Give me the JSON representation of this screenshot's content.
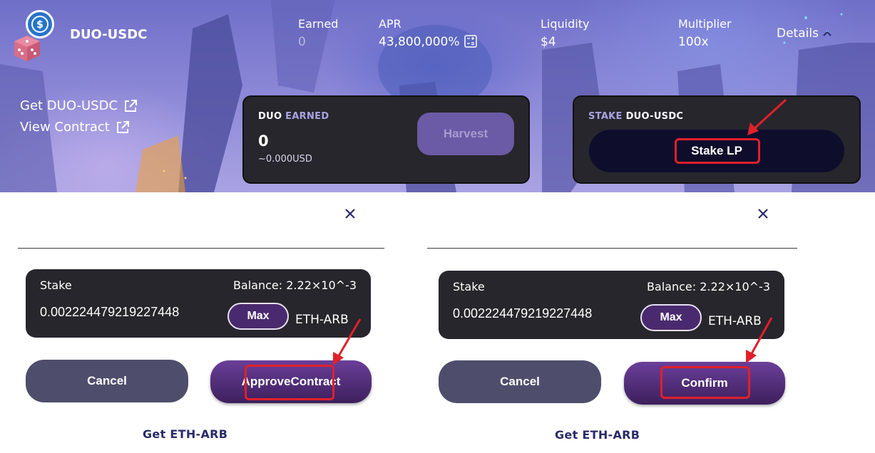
{
  "farm": {
    "pair_name": "DUO-USDC",
    "stats": {
      "earned_label": "Earned",
      "earned_value": "0",
      "apr_label": "APR",
      "apr_value": "43,800,000%",
      "liquidity_label": "Liquidity",
      "liquidity_value": "$4",
      "multiplier_label": "Multiplier",
      "multiplier_value": "100x"
    },
    "details_label": "Details",
    "links": {
      "get_pair": "Get DUO-USDC",
      "view_contract": "View Contract"
    },
    "earned_card": {
      "title_token": "DUO",
      "title_suffix": "EARNED",
      "value": "0",
      "usd_value": "~0.000USD",
      "harvest_label": "Harvest"
    },
    "stake_card": {
      "title_prefix": "STAKE",
      "title_token": "DUO-USDC",
      "stake_lp_label": "Stake LP"
    }
  },
  "modal_approve": {
    "stake_label": "Stake",
    "balance": "Balance: 2.22×10^-3",
    "input_value": "0.002224479219227448",
    "max_label": "Max",
    "token": "ETH-ARB",
    "cancel_label": "Cancel",
    "primary_label_line1": "Approve",
    "primary_label_line2": "Contract",
    "get_token_link": "Get ETH-ARB"
  },
  "modal_confirm": {
    "stake_label": "Stake",
    "balance": "Balance: 2.22×10^-3",
    "input_value": "0.002224479219227448",
    "max_label": "Max",
    "token": "ETH-ARB",
    "cancel_label": "Cancel",
    "primary_label": "Confirm",
    "get_token_link": "Get ETH-ARB"
  },
  "colors": {
    "card_bg": "#27262c",
    "accent_purple": "#a9a3e2",
    "highlight_red": "#e0202a",
    "cancel_bg": "#4e4e6c",
    "primary_gradient_top": "#6a3f9a",
    "link_navy": "#2a2a6a"
  },
  "icons": {
    "close": "close-icon",
    "external_link": "external-link-icon",
    "calculator": "calculator-icon",
    "chevron": "chevron-up-icon",
    "usdc": "usdc-icon",
    "dice": "dice-icon"
  }
}
